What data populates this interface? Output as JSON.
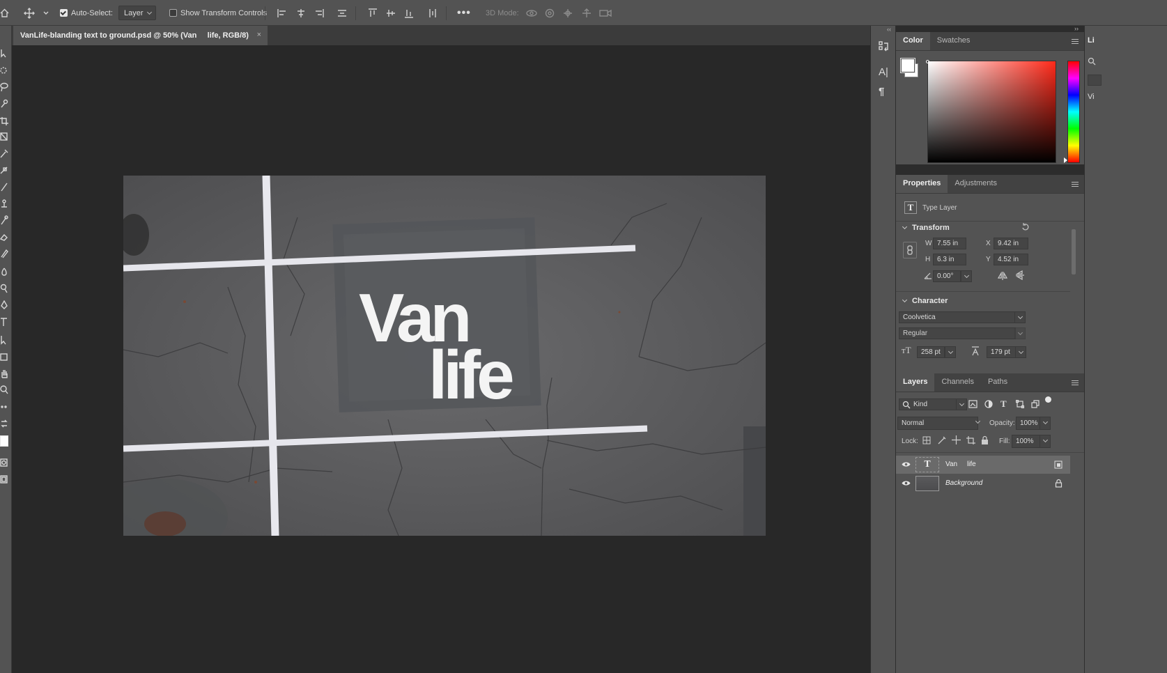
{
  "options_bar": {
    "auto_select_label": "Auto-Select:",
    "auto_select_target": "Layer",
    "show_transform_label": "Show Transform Controls",
    "mode_3d_label": "3D Mode:"
  },
  "document": {
    "tab_title": "VanLife-blanding text to ground.psd @ 50% (Van     life, RGB/8)",
    "close_glyph": "×",
    "canvas_text_line1": "Van",
    "canvas_text_line2": "life"
  },
  "color_panel": {
    "tabs": [
      "Color",
      "Swatches"
    ],
    "foreground_color": "#ffffff",
    "background_color": "#ffffff",
    "field_hue_color": "#ff2a1a"
  },
  "properties_panel": {
    "tabs": [
      "Properties",
      "Adjustments"
    ],
    "layer_kind": "Type Layer",
    "transform": {
      "title": "Transform",
      "w_label": "W",
      "w": "7.55 in",
      "h_label": "H",
      "h": "6.3 in",
      "x_label": "X",
      "x": "9.42 in",
      "y_label": "Y",
      "y": "4.52 in",
      "angle": "0.00°"
    },
    "character": {
      "title": "Character",
      "font": "Coolvetica",
      "style": "Regular",
      "size": "258 pt",
      "leading": "179 pt"
    }
  },
  "layers_panel": {
    "tabs": [
      "Layers",
      "Channels",
      "Paths"
    ],
    "filter": "Kind",
    "blend_mode": "Normal",
    "opacity_label": "Opacity:",
    "opacity": "100%",
    "lock_label": "Lock:",
    "fill_label": "Fill:",
    "fill": "100%",
    "layers": [
      {
        "name": "Van     life",
        "type": "text",
        "selected": true
      },
      {
        "name": "Background",
        "type": "image",
        "selected": false
      }
    ]
  },
  "right_sliver": {
    "tab_fragment": "Li",
    "text_fragment": "Vi"
  }
}
